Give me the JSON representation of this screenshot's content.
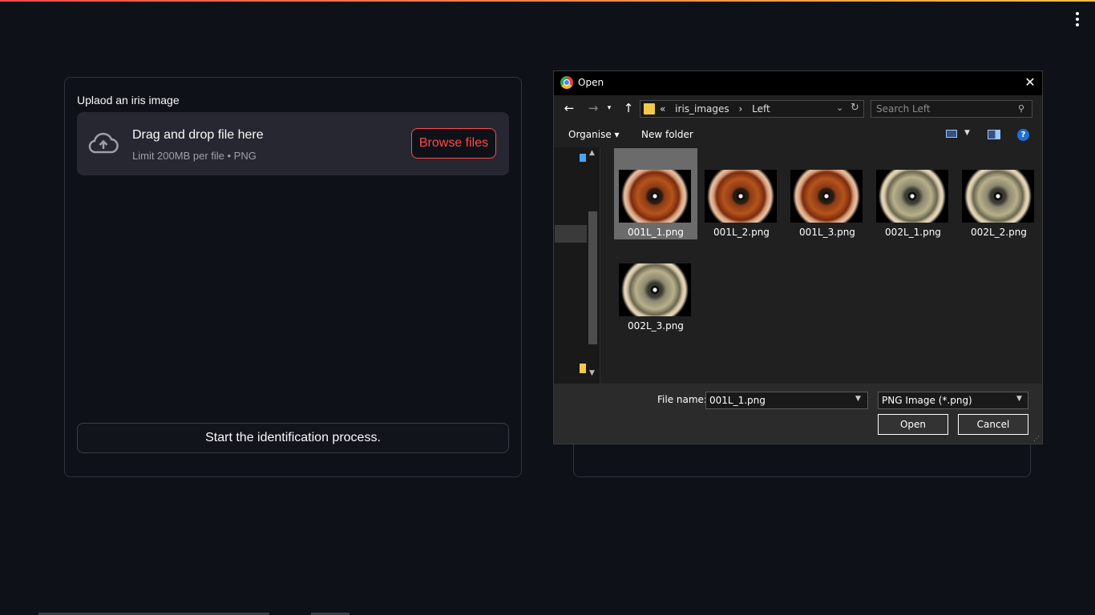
{
  "app": {
    "menu_icon": "kebab-menu-icon",
    "accent": "#ff4b4b"
  },
  "uploader": {
    "label": "Uplaod an iris image",
    "drop_title": "Drag and drop file here",
    "drop_sub": "Limit 200MB per file • PNG",
    "browse": "Browse files",
    "icon": "cloud-upload-icon"
  },
  "start_button": "Start the identification process.",
  "dialog": {
    "title": "Open",
    "close": "✕",
    "breadcrumb": [
      "«",
      "iris_images",
      "›",
      "Left"
    ],
    "search_placeholder": "Search Left",
    "toolbar": {
      "organise": "Organise ▾",
      "new_folder": "New folder",
      "help": "?"
    },
    "files": [
      {
        "name": "001L_1.png",
        "tone": "brown",
        "selected": true
      },
      {
        "name": "001L_2.png",
        "tone": "brown",
        "selected": false
      },
      {
        "name": "001L_3.png",
        "tone": "brown",
        "selected": false
      },
      {
        "name": "002L_1.png",
        "tone": "hazel",
        "selected": false
      },
      {
        "name": "002L_2.png",
        "tone": "hazel",
        "selected": false
      },
      {
        "name": "002L_3.png",
        "tone": "hazel",
        "selected": false
      }
    ],
    "file_name_label": "File name:",
    "file_name_value": "001L_1.png",
    "file_type": "PNG Image (*.png)",
    "open_button": "Open",
    "cancel_button": "Cancel"
  }
}
